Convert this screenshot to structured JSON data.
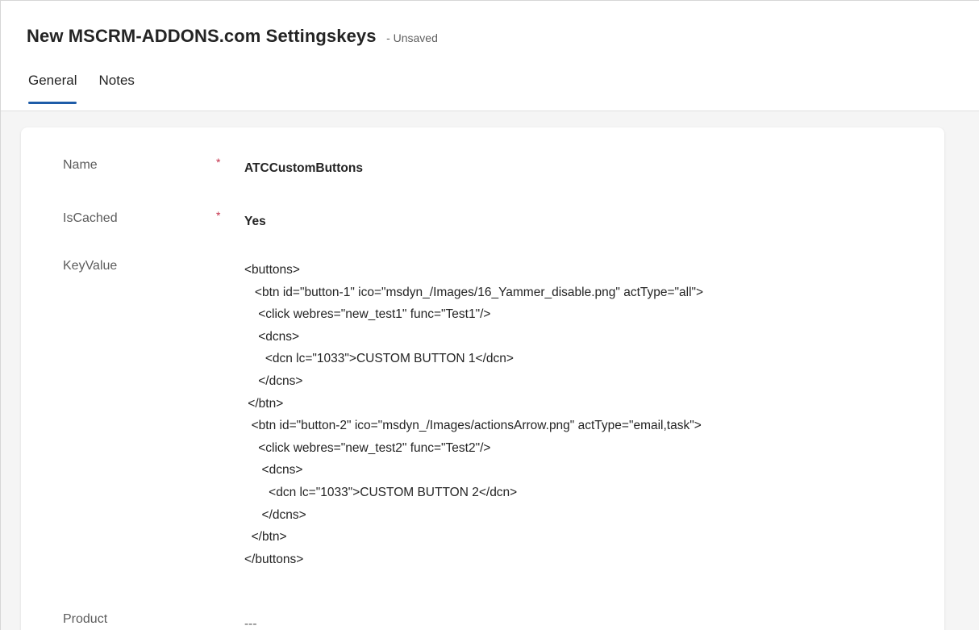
{
  "header": {
    "title": "New MSCRM-ADDONS.com Settingskeys",
    "save_status": "- Unsaved"
  },
  "tabs": [
    {
      "label": "General",
      "active": true
    },
    {
      "label": "Notes",
      "active": false
    }
  ],
  "form": {
    "name": {
      "label": "Name",
      "required_marker": "*",
      "value": "ATCCustomButtons"
    },
    "is_cached": {
      "label": "IsCached",
      "required_marker": "*",
      "value": "Yes"
    },
    "key_value": {
      "label": "KeyValue",
      "lines": [
        "<buttons>",
        "   <btn id=\"button-1\" ico=\"msdyn_/Images/16_Yammer_disable.png\" actType=\"all\">",
        "    <click webres=\"new_test1\" func=\"Test1\"/>",
        "    <dcns>",
        "      <dcn lc=\"1033\">CUSTOM BUTTON 1</dcn>",
        "    </dcns>",
        " </btn>",
        "  <btn id=\"button-2\" ico=\"msdyn_/Images/actionsArrow.png\" actType=\"email,task\">",
        "    <click webres=\"new_test2\" func=\"Test2\"/>",
        "     <dcns>",
        "       <dcn lc=\"1033\">CUSTOM BUTTON 2</dcn>",
        "     </dcns>",
        "  </btn>",
        "</buttons>"
      ]
    },
    "product": {
      "label": "Product",
      "value": "---"
    }
  },
  "colors": {
    "tab_indicator": "#1e5ca8",
    "required": "#c4314b",
    "background": "#f5f5f5",
    "card": "#ffffff"
  }
}
